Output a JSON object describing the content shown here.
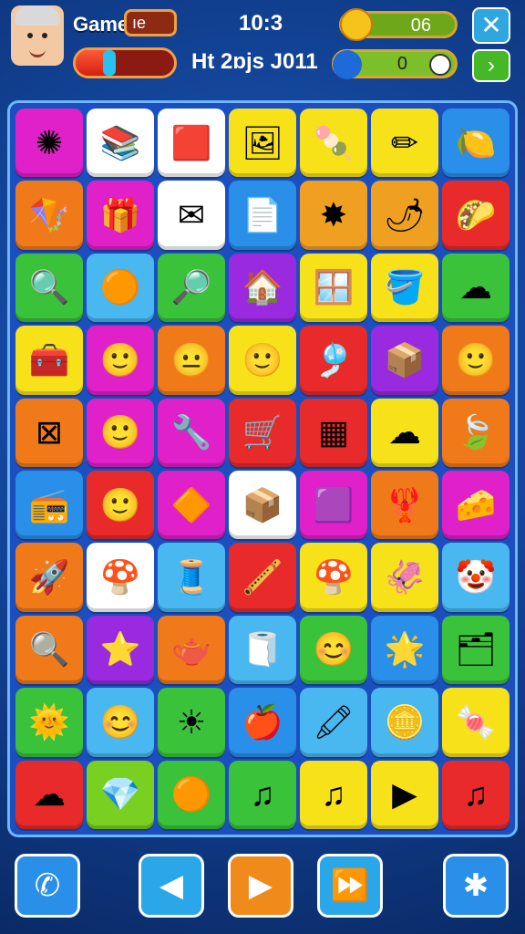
{
  "header": {
    "title": "Game",
    "title_box": "ıe",
    "time": "10:3",
    "subtitle": "Ht 2ɒjs J011",
    "coins": "06",
    "gems": "0",
    "health_fraction": 0.35
  },
  "colors": {
    "board": "#1b4fc0",
    "accent": "#f0a040"
  },
  "board": {
    "tiles": [
      {
        "color": "#e020c8",
        "icon": "badge-icon",
        "glyph": "✺"
      },
      {
        "color": "#ffffff",
        "icon": "books-icon",
        "glyph": "📚"
      },
      {
        "color": "#ffffff",
        "icon": "cube-icon",
        "glyph": "🟥"
      },
      {
        "color": "#f7e21a",
        "icon": "frame-icon",
        "glyph": "🖼"
      },
      {
        "color": "#f7e21a",
        "icon": "popsicle-icon",
        "glyph": "🍡"
      },
      {
        "color": "#f7e21a",
        "icon": "pencil-icon",
        "glyph": "✏"
      },
      {
        "color": "#2a8fe8",
        "icon": "lemon-icon",
        "glyph": "🍋"
      },
      {
        "color": "#f07a1a",
        "icon": "kite-icon",
        "glyph": "🪁"
      },
      {
        "color": "#e020c8",
        "icon": "gift-box-icon",
        "glyph": "🎁"
      },
      {
        "color": "#ffffff",
        "icon": "envelope-icon",
        "glyph": "✉"
      },
      {
        "color": "#2a8fe8",
        "icon": "paper-stack-icon",
        "glyph": "📄"
      },
      {
        "color": "#f0a020",
        "icon": "star-burst-icon",
        "glyph": "✸"
      },
      {
        "color": "#f0a020",
        "icon": "radish-icon",
        "glyph": "🌶"
      },
      {
        "color": "#e82a2a",
        "icon": "taco-icon",
        "glyph": "🌮"
      },
      {
        "color": "#3ac23a",
        "icon": "magnifier-icon",
        "glyph": "🔍"
      },
      {
        "color": "#4ab8f0",
        "icon": "blob-icon",
        "glyph": "🟠"
      },
      {
        "color": "#3ac23a",
        "icon": "magnifier-icon",
        "glyph": "🔎"
      },
      {
        "color": "#9a2ae0",
        "icon": "house-icon",
        "glyph": "🏠"
      },
      {
        "color": "#f7e21a",
        "icon": "window-icon",
        "glyph": "🪟"
      },
      {
        "color": "#f7e21a",
        "icon": "bucket-icon",
        "glyph": "🪣"
      },
      {
        "color": "#3ac23a",
        "icon": "cloud-icon",
        "glyph": "☁"
      },
      {
        "color": "#f7e21a",
        "icon": "chest-icon",
        "glyph": "🧰"
      },
      {
        "color": "#e020c8",
        "icon": "face-icon",
        "glyph": "🙂"
      },
      {
        "color": "#f07a1a",
        "icon": "face-icon",
        "glyph": "😐"
      },
      {
        "color": "#f7e21a",
        "icon": "face-icon",
        "glyph": "🙂"
      },
      {
        "color": "#e82a2a",
        "icon": "fan-icon",
        "glyph": "🎐"
      },
      {
        "color": "#9a2ae0",
        "icon": "box-icon",
        "glyph": "📦"
      },
      {
        "color": "#f07a1a",
        "icon": "face-icon",
        "glyph": "🙂"
      },
      {
        "color": "#f07a1a",
        "icon": "crate-icon",
        "glyph": "⊠"
      },
      {
        "color": "#e020c8",
        "icon": "face-icon",
        "glyph": "🙂"
      },
      {
        "color": "#e020c8",
        "icon": "wrench-icon",
        "glyph": "🔧"
      },
      {
        "color": "#e82a2a",
        "icon": "cart-icon",
        "glyph": "🛒"
      },
      {
        "color": "#e82a2a",
        "icon": "grid-icon",
        "glyph": "▦"
      },
      {
        "color": "#f7e21a",
        "icon": "cloud-icon",
        "glyph": "☁"
      },
      {
        "color": "#f07a1a",
        "icon": "leaf-icon",
        "glyph": "🍃"
      },
      {
        "color": "#2a8fe8",
        "icon": "radio-icon",
        "glyph": "📻"
      },
      {
        "color": "#e82a2a",
        "icon": "face-icon",
        "glyph": "🙂"
      },
      {
        "color": "#e020c8",
        "icon": "cone-icon",
        "glyph": "🔶"
      },
      {
        "color": "#ffffff",
        "icon": "package-icon",
        "glyph": "📦"
      },
      {
        "color": "#e020c8",
        "icon": "box-icon",
        "glyph": "🟪"
      },
      {
        "color": "#f07a1a",
        "icon": "figure-icon",
        "glyph": "🦞"
      },
      {
        "color": "#e020c8",
        "icon": "cheese-icon",
        "glyph": "🧀"
      },
      {
        "color": "#f07a1a",
        "icon": "rocket-icon",
        "glyph": "🚀"
      },
      {
        "color": "#ffffff",
        "icon": "mushroom-icon",
        "glyph": "🍄"
      },
      {
        "color": "#4ab8f0",
        "icon": "spool-icon",
        "glyph": "🧵"
      },
      {
        "color": "#e82a2a",
        "icon": "pipe-icon",
        "glyph": "🪈"
      },
      {
        "color": "#f7e21a",
        "icon": "mushroom-icon",
        "glyph": "🍄"
      },
      {
        "color": "#f7e21a",
        "icon": "squid-icon",
        "glyph": "🦑"
      },
      {
        "color": "#4ab8f0",
        "icon": "clown-icon",
        "glyph": "🤡"
      },
      {
        "color": "#f07a1a",
        "icon": "magnifier-icon",
        "glyph": "🔍"
      },
      {
        "color": "#9a2ae0",
        "icon": "star-icon",
        "glyph": "⭐"
      },
      {
        "color": "#f07a1a",
        "icon": "teapot-icon",
        "glyph": "🫖"
      },
      {
        "color": "#4ab8f0",
        "icon": "roll-icon",
        "glyph": "🧻"
      },
      {
        "color": "#3ac23a",
        "icon": "smiley-icon",
        "glyph": "😊"
      },
      {
        "color": "#2a8fe8",
        "icon": "star-face-icon",
        "glyph": "🌟"
      },
      {
        "color": "#3ac23a",
        "icon": "board-icon",
        "glyph": "🗂"
      },
      {
        "color": "#3ac23a",
        "icon": "sun-face-icon",
        "glyph": "🌞"
      },
      {
        "color": "#4ab8f0",
        "icon": "smiley-icon",
        "glyph": "😊"
      },
      {
        "color": "#3ac23a",
        "icon": "sun-icon",
        "glyph": "☀"
      },
      {
        "color": "#2a8fe8",
        "icon": "apple-icon",
        "glyph": "🍎"
      },
      {
        "color": "#4ab8f0",
        "icon": "marker-icon",
        "glyph": "🖍"
      },
      {
        "color": "#4ab8f0",
        "icon": "coin-icon",
        "glyph": "🪙"
      },
      {
        "color": "#f7e21a",
        "icon": "candy-icon",
        "glyph": "🍬"
      },
      {
        "color": "#e82a2a",
        "icon": "cloud-icon",
        "glyph": "☁"
      },
      {
        "color": "#7ad020",
        "icon": "gem-icon",
        "glyph": "💎"
      },
      {
        "color": "#3ac23a",
        "icon": "blob-icon",
        "glyph": "🟠"
      },
      {
        "color": "#3ac23a",
        "icon": "music-note-icon",
        "glyph": "♫"
      },
      {
        "color": "#f7e21a",
        "icon": "music-note-icon",
        "glyph": "♫"
      },
      {
        "color": "#f7e21a",
        "icon": "play-triangle-icon",
        "glyph": "▶"
      },
      {
        "color": "#e82a2a",
        "icon": "music-note-icon",
        "glyph": "♫"
      }
    ]
  },
  "bottom_bar": [
    {
      "name": "phone-button",
      "icon": "phone-icon",
      "glyph": "✆",
      "color": "#2a8fe8"
    },
    {
      "name": "sound-button",
      "icon": "speaker-icon",
      "glyph": "◀",
      "color": "#2aa7e8"
    },
    {
      "name": "play-button",
      "icon": "play-icon",
      "glyph": "▶",
      "color": "#f08a1a"
    },
    {
      "name": "forward-button",
      "icon": "forward-icon",
      "glyph": "⏩",
      "color": "#2aa7e8"
    },
    {
      "name": "settings-button",
      "icon": "snowflake-icon",
      "glyph": "✱",
      "color": "#2a8fe8"
    }
  ]
}
